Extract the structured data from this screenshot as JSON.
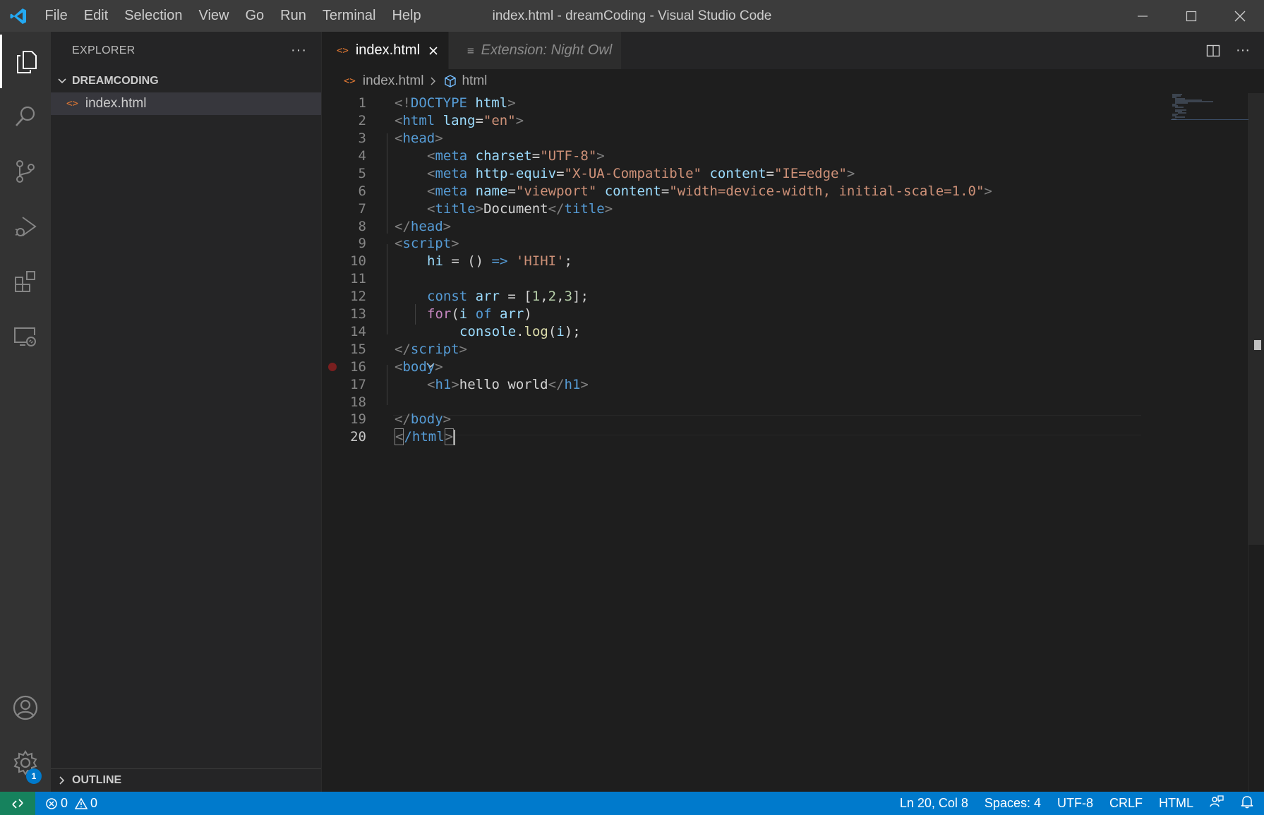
{
  "titlebar": {
    "menu": [
      "File",
      "Edit",
      "Selection",
      "View",
      "Go",
      "Run",
      "Terminal",
      "Help"
    ],
    "window_title": "index.html - dreamCoding - Visual Studio Code"
  },
  "activitybar": {
    "items": [
      "explorer-icon",
      "search-icon",
      "source-control-icon",
      "run-debug-icon",
      "extensions-icon",
      "remote-explorer-icon"
    ],
    "bottom": [
      "account-icon",
      "settings-gear-icon"
    ],
    "settings_badge": "1"
  },
  "sidebar": {
    "header": "EXPLORER",
    "folder": "DREAMCODING",
    "files": [
      {
        "name": "index.html",
        "icon": "<>"
      }
    ],
    "outline": "OUTLINE"
  },
  "tabs": [
    {
      "label": "index.html",
      "icon": "<>",
      "active": true
    },
    {
      "label": "Extension: Night Owl",
      "icon": "≡",
      "active": false
    }
  ],
  "breadcrumb": {
    "file": "index.html",
    "symbol": "html"
  },
  "editor": {
    "line_numbers": [
      "1",
      "2",
      "3",
      "4",
      "5",
      "6",
      "7",
      "8",
      "9",
      "10",
      "11",
      "12",
      "13",
      "14",
      "15",
      "16",
      "17",
      "18",
      "19",
      "20"
    ],
    "current_line": "20",
    "tokens": {
      "l1": [
        "<!",
        "DOCTYPE",
        " ",
        "html",
        ">"
      ],
      "l2": [
        "<",
        "html",
        " ",
        "lang",
        "=",
        "\"en\"",
        ">"
      ],
      "l3": [
        "<",
        "head",
        ">"
      ],
      "l4": [
        "<",
        "meta",
        " ",
        "charset",
        "=",
        "\"UTF-8\"",
        ">"
      ],
      "l5": [
        "<",
        "meta",
        " ",
        "http-equiv",
        "=",
        "\"X-UA-Compatible\"",
        " ",
        "content",
        "=",
        "\"IE=edge\"",
        ">"
      ],
      "l6": [
        "<",
        "meta",
        " ",
        "name",
        "=",
        "\"viewport\"",
        " ",
        "content",
        "=",
        "\"width=device-width, initial-scale=1.0\"",
        ">"
      ],
      "l7": [
        "<",
        "title",
        ">",
        "Document",
        "</",
        "title",
        ">"
      ],
      "l8": [
        "</",
        "head",
        ">"
      ],
      "l9": [
        "<",
        "script",
        ">"
      ],
      "l10": [
        "hi",
        " = () ",
        "=>",
        " ",
        "'HIHI'",
        ";"
      ],
      "l12": [
        "const",
        " ",
        "arr",
        " = [",
        "1",
        ",",
        "2",
        ",",
        "3",
        "];"
      ],
      "l13": [
        "for",
        "(",
        "i",
        " ",
        "of",
        " ",
        "arr",
        ")"
      ],
      "l14": [
        "console",
        ".",
        "log",
        "(",
        "i",
        ");"
      ],
      "l15": [
        "</",
        "script",
        ">"
      ],
      "l16": [
        "<",
        "body",
        ">"
      ],
      "l17": [
        "<",
        "h1",
        ">",
        "hello world",
        "</",
        "h1",
        ">"
      ],
      "l19": [
        "</",
        "body",
        ">"
      ],
      "l20": [
        "<",
        "/html",
        ">"
      ]
    }
  },
  "statusbar": {
    "errors": "0",
    "warnings": "0",
    "position": "Ln 20, Col 8",
    "spaces": "Spaces: 4",
    "encoding": "UTF-8",
    "eol": "CRLF",
    "language": "HTML"
  },
  "colors": {
    "statusbar": "#007acc",
    "remote": "#16825d",
    "tag": "#569cd6",
    "attr": "#9cdcfe",
    "string": "#ce9178",
    "control": "#c586c0"
  }
}
